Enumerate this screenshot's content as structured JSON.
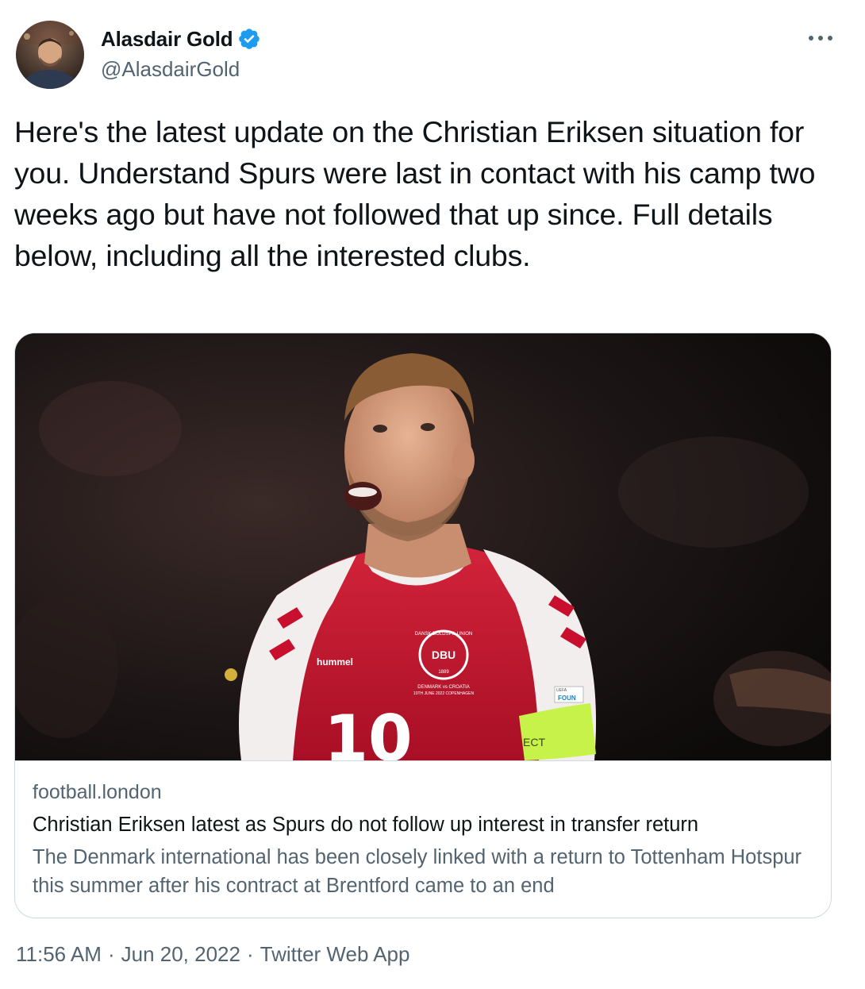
{
  "author": {
    "display_name": "Alasdair Gold",
    "handle": "@AlasdairGold",
    "verified": true,
    "verified_color": "#1d9bf0"
  },
  "tweet": {
    "text": "Here's the latest update on the Christian Eriksen situation for you. Understand Spurs were last in contact with his camp two weeks ago but have not followed that up since. Full details below, including all the interested clubs."
  },
  "card": {
    "image_icon": "photo-of-footballer-in-denmark-kit",
    "jersey_number": "10",
    "jersey_brand": "hummel",
    "jersey_crest": "DBU",
    "jersey_crest_ring": "DANSK BOLDSPIL UNION",
    "jersey_crest_year": "1889",
    "jersey_match_line_1": "DENMARK vs CROATIA",
    "jersey_match_line_2": "10TH JUNE 2022 COPENHAGEN",
    "armband_text": "ECT",
    "sleeve_patch_text": "FOUN",
    "sleeve_patch_top": "UEFA",
    "domain": "football.london",
    "title": "Christian Eriksen latest as Spurs do not follow up interest in transfer return",
    "description": "The Denmark international has been closely linked with a return to Tottenham Hotspur this summer after his contract at Brentford came to an end"
  },
  "meta": {
    "time": "11:56 AM",
    "date": "Jun 20, 2022",
    "source": "Twitter Web App",
    "separator": "·"
  },
  "colors": {
    "text_primary": "#0f1419",
    "text_secondary": "#536471",
    "border": "#cfd9de",
    "jersey_red": "#c8102e",
    "armband_green": "#c6f24a"
  }
}
